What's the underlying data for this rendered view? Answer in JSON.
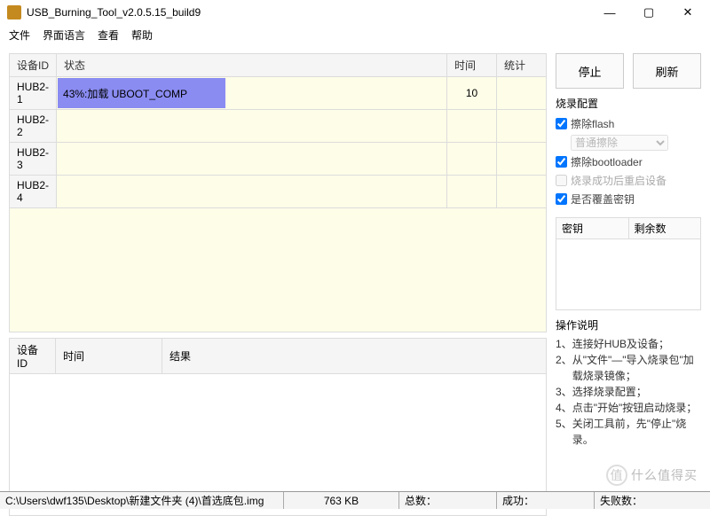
{
  "window": {
    "title": "USB_Burning_Tool_v2.0.5.15_build9"
  },
  "menu": {
    "file": "文件",
    "lang": "界面语言",
    "view": "查看",
    "help": "帮助"
  },
  "headers": {
    "devid": "设备ID",
    "status": "状态",
    "time": "时间",
    "stat": "统计",
    "result": "结果"
  },
  "devices": [
    {
      "id": "HUB2-1",
      "progress_pct": 43,
      "text": "43%:加载 UBOOT_COMP",
      "time": "10",
      "stat": ""
    },
    {
      "id": "HUB2-2",
      "progress_pct": 0,
      "text": "",
      "time": "",
      "stat": ""
    },
    {
      "id": "HUB2-3",
      "progress_pct": 0,
      "text": "",
      "time": "",
      "stat": ""
    },
    {
      "id": "HUB2-4",
      "progress_pct": 0,
      "text": "",
      "time": "",
      "stat": ""
    }
  ],
  "buttons": {
    "stop": "停止",
    "refresh": "刷新"
  },
  "config": {
    "title": "烧录配置",
    "erase_flash": "擦除flash",
    "erase_mode": "普通擦除",
    "erase_bootloader": "擦除bootloader",
    "reboot_after": "烧录成功后重启设备",
    "overwrite_key": "是否覆盖密钥"
  },
  "keys": {
    "col1": "密钥",
    "col2": "剩余数"
  },
  "instructions": {
    "title": "操作说明",
    "steps": [
      "连接好HUB及设备；",
      "从\"文件\"—\"导入烧录包\"加载烧录镜像；",
      "选择烧录配置；",
      "点击\"开始\"按钮启动烧录；",
      "关闭工具前，先\"停止\"烧录。"
    ]
  },
  "statusbar": {
    "path": "C:\\Users\\dwf135\\Desktop\\新建文件夹 (4)\\首选底包.img",
    "size": "763 KB",
    "total": "总数：",
    "success": "成功：",
    "fail": "失败数："
  },
  "watermark": "什么值得买"
}
